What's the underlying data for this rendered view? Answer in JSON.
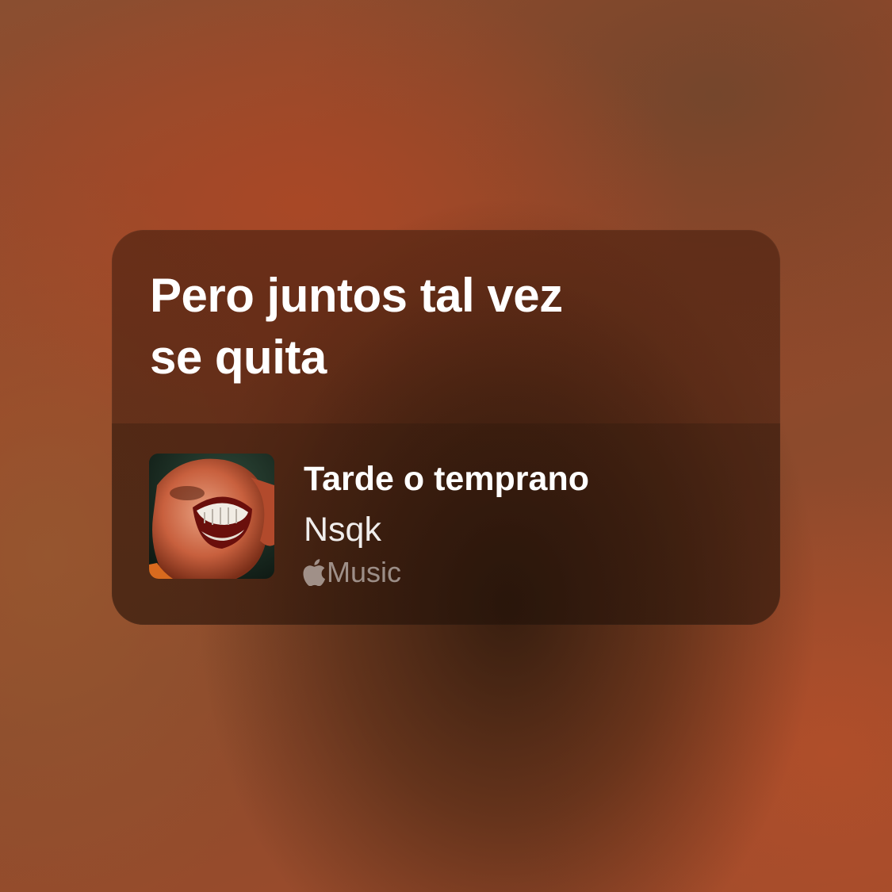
{
  "lyric_card": {
    "lyric_lines": [
      "Pero juntos tal vez",
      "se quita"
    ],
    "track": {
      "title": "Tarde o temprano",
      "artist": "Nsqk",
      "artwork": "album-cover-image"
    },
    "service": {
      "icon": "apple-logo-icon",
      "label": "Music"
    }
  },
  "colors": {
    "background": "#9a4a2a",
    "card": "#48221280",
    "text_primary": "#ffffff",
    "text_muted": "#ffffff80"
  }
}
